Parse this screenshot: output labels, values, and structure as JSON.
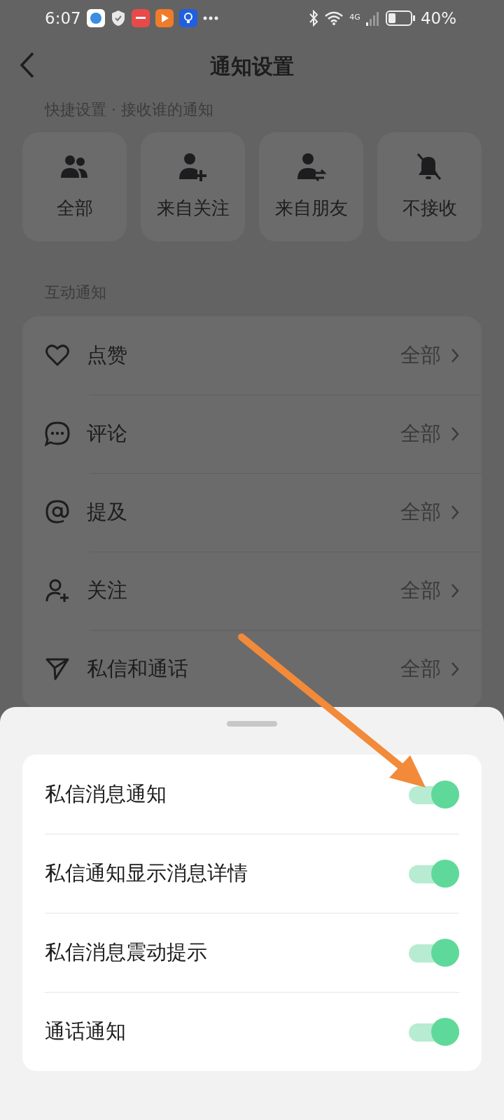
{
  "status_bar": {
    "time": "6:07",
    "network": "4G",
    "battery": "40%"
  },
  "header": {
    "title": "通知设置"
  },
  "quick_settings": {
    "label": "快捷设置 · 接收谁的通知",
    "options": [
      {
        "kind": "all",
        "label": "全部"
      },
      {
        "kind": "following",
        "label": "来自关注"
      },
      {
        "kind": "friends",
        "label": "来自朋友"
      },
      {
        "kind": "none",
        "label": "不接收"
      }
    ]
  },
  "interaction": {
    "label": "互动通知",
    "rows": [
      {
        "kind": "like",
        "label": "点赞",
        "value": "全部"
      },
      {
        "kind": "comment",
        "label": "评论",
        "value": "全部"
      },
      {
        "kind": "mention",
        "label": "提及",
        "value": "全部"
      },
      {
        "kind": "follow",
        "label": "关注",
        "value": "全部"
      },
      {
        "kind": "message",
        "label": "私信和通话",
        "value": "全部"
      }
    ]
  },
  "sheet": {
    "toggles": [
      {
        "label": "私信消息通知",
        "on": true
      },
      {
        "label": "私信通知显示消息详情",
        "on": true
      },
      {
        "label": "私信消息震动提示",
        "on": true
      },
      {
        "label": "通话通知",
        "on": true
      }
    ]
  }
}
